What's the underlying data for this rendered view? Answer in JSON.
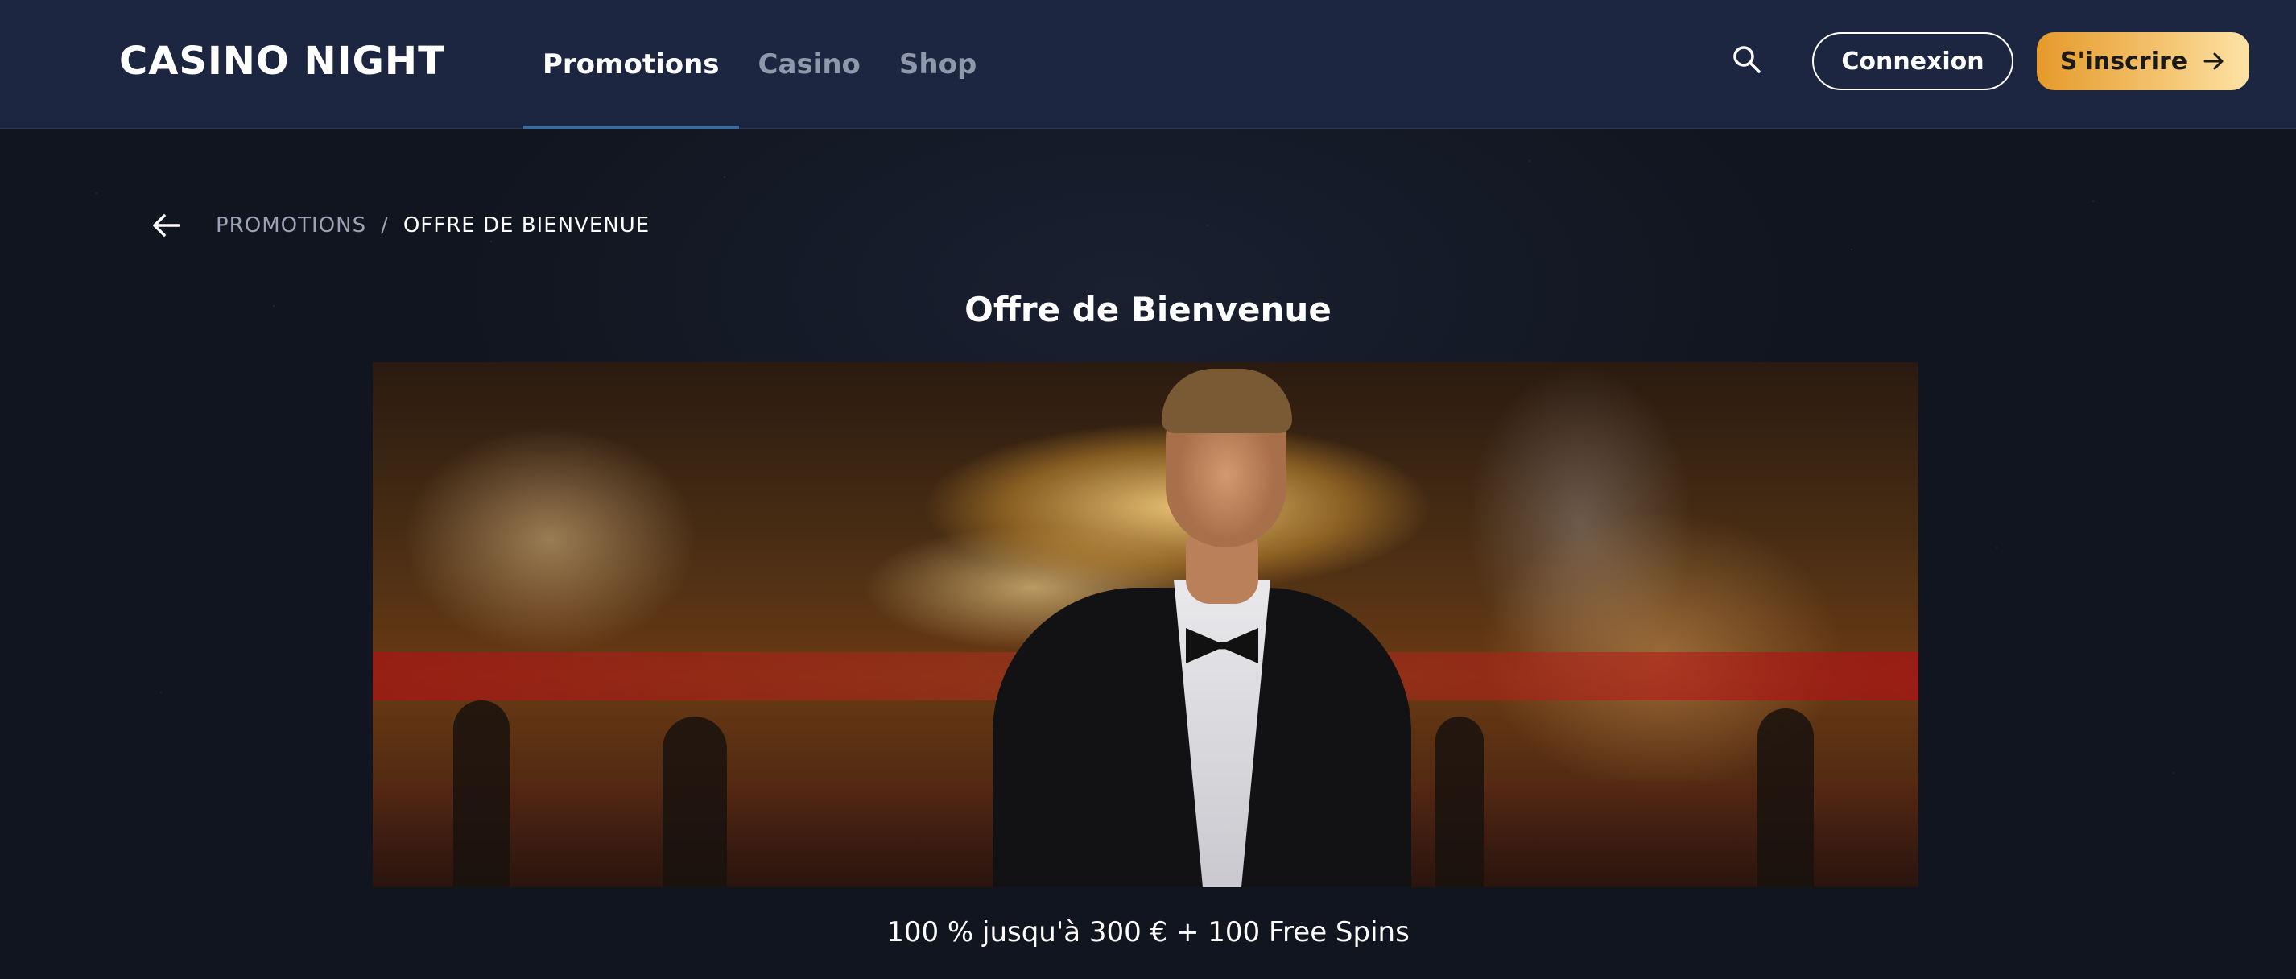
{
  "header": {
    "logo_text": "CASINO NIGHT",
    "nav": [
      {
        "label": "Promotions",
        "active": true
      },
      {
        "label": "Casino",
        "active": false
      },
      {
        "label": "Shop",
        "active": false
      }
    ],
    "search_icon": "search-icon",
    "login_label": "Connexion",
    "signup_label": "S'inscrire",
    "signup_icon": "arrow-right-icon"
  },
  "breadcrumb": {
    "back_icon": "arrow-left-icon",
    "parent": "PROMOTIONS",
    "separator": "/",
    "current": "OFFRE DE BIENVENUE"
  },
  "main": {
    "title": "Offre de Bienvenue",
    "offer_text": "100 % jusqu'à 300 € + 100 Free Spins"
  },
  "colors": {
    "header_bg": "#1c2640",
    "page_bg": "#11151f",
    "accent_gold": "#f4c470",
    "nav_active_underline": "#3a6a9a"
  }
}
